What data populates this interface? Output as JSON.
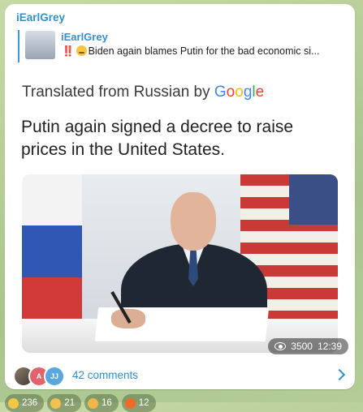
{
  "message": {
    "sender": "iEarlGrey",
    "reply": {
      "name": "iEarlGrey",
      "emoji_prefix": "‼️",
      "text": "Biden again blames Putin for the bad economic si..."
    },
    "media": {
      "translated_prefix": "Translated from Russian by ",
      "translated_brand": "Google",
      "headline": "Putin again signed a decree to raise prices in the United States.",
      "views": "3500",
      "time": "12:39"
    },
    "comments": {
      "avatars": [
        "",
        "A",
        "JJ"
      ],
      "label": "42 comments"
    },
    "reactions": [
      {
        "icon": "face-emoji-icon",
        "count": "236"
      },
      {
        "icon": "thumbs-up-icon",
        "count": "21"
      },
      {
        "icon": "clapping-icon",
        "count": "16"
      },
      {
        "icon": "fire-icon",
        "count": "12"
      }
    ]
  },
  "colors": {
    "accent": "#3390c7",
    "bubble": "#ffffff",
    "background": "#b9cf9d"
  }
}
